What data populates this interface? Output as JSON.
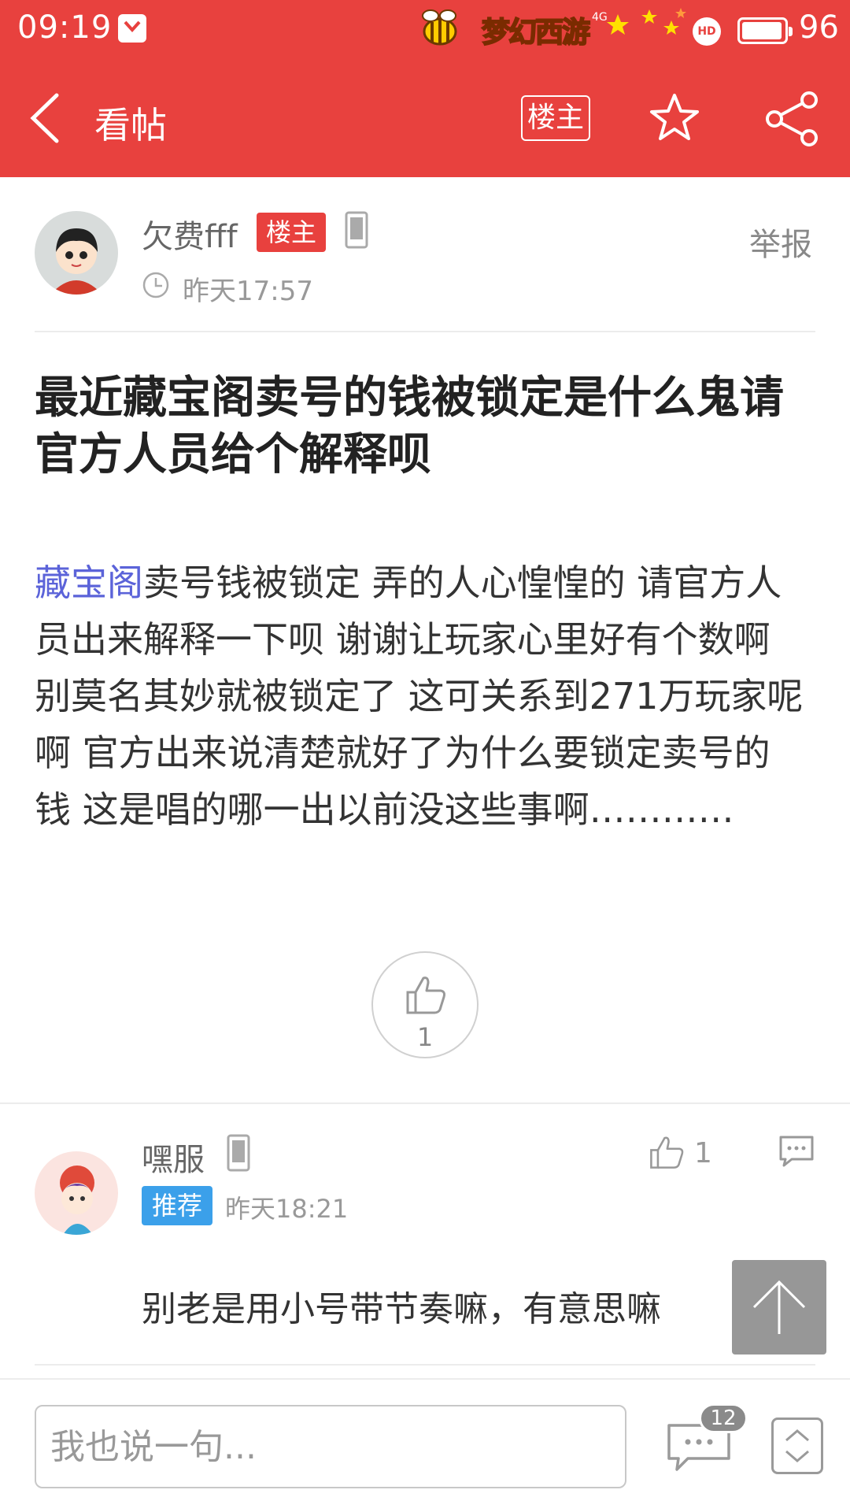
{
  "status_bar": {
    "time": "09:19",
    "app_logo_text": "梦幻西游",
    "network": "4G",
    "hd": "HD",
    "battery_percent": 96,
    "battery_text": "96"
  },
  "header": {
    "back_label": "<",
    "title": "看帖",
    "owner_only_label": "楼主"
  },
  "post": {
    "author": "欠费fff",
    "author_badge": "楼主",
    "report_label": "举报",
    "time": "昨天17:57",
    "title": "最近藏宝阁卖号的钱被锁定是什么鬼请官方人员给个解释呗",
    "body_link": "藏宝阁",
    "body_text": "卖号钱被锁定 弄的人心惶惶的   请官方人员出来解释一下呗 谢谢让玩家心里好有个数啊 别莫名其妙就被锁定了   这可关系到271万玩家呢啊 官方出来说清楚就好了为什么要锁定卖号的钱 这是唱的哪一出以前没这些事啊…………",
    "like_count": "1"
  },
  "reply": {
    "author": "嘿服",
    "badge": "推荐",
    "time": "昨天18:21",
    "like_count": "1",
    "text": "别老是用小号带节奏嘛，有意思嘛"
  },
  "bottom_bar": {
    "input_placeholder": "我也说一句...",
    "comment_count": "12"
  },
  "colors": {
    "brand_red": "#e8413e",
    "link_blue": "#5b63d9",
    "recommend_blue": "#3ba0ea"
  }
}
